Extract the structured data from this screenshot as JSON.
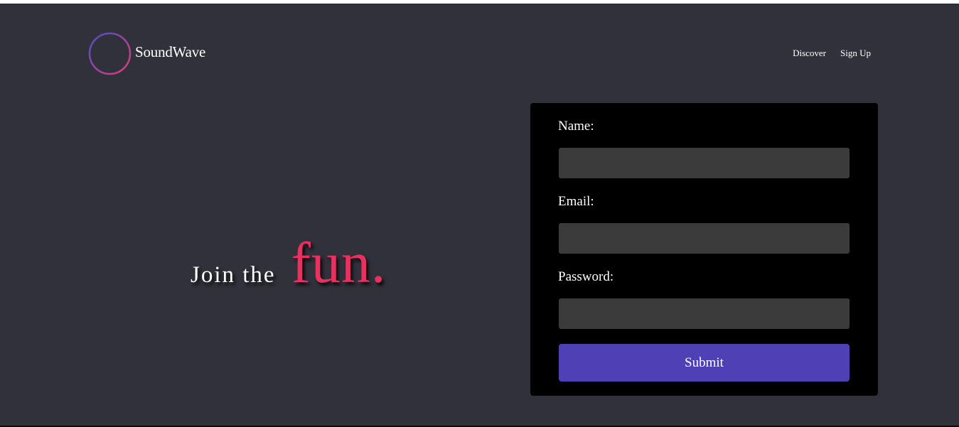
{
  "header": {
    "brand": "SoundWave",
    "nav": [
      {
        "label": "Discover"
      },
      {
        "label": "Sign Up"
      }
    ]
  },
  "hero": {
    "lead": "Join the",
    "accent": "fun."
  },
  "form": {
    "fields": [
      {
        "label": "Name:",
        "value": "",
        "placeholder": ""
      },
      {
        "label": "Email:",
        "value": "",
        "placeholder": ""
      },
      {
        "label": "Password:",
        "value": "",
        "placeholder": ""
      }
    ],
    "submit_label": "Submit"
  },
  "colors": {
    "background": "#31313b",
    "card": "#000000",
    "input": "#3b3b3b",
    "accent": "#e8315f",
    "button": "#5040b6",
    "logo_gradient_start": "#4a4fc4",
    "logo_gradient_end": "#e33a78"
  },
  "icons": {
    "logo": "soundwave-logo-icon"
  }
}
